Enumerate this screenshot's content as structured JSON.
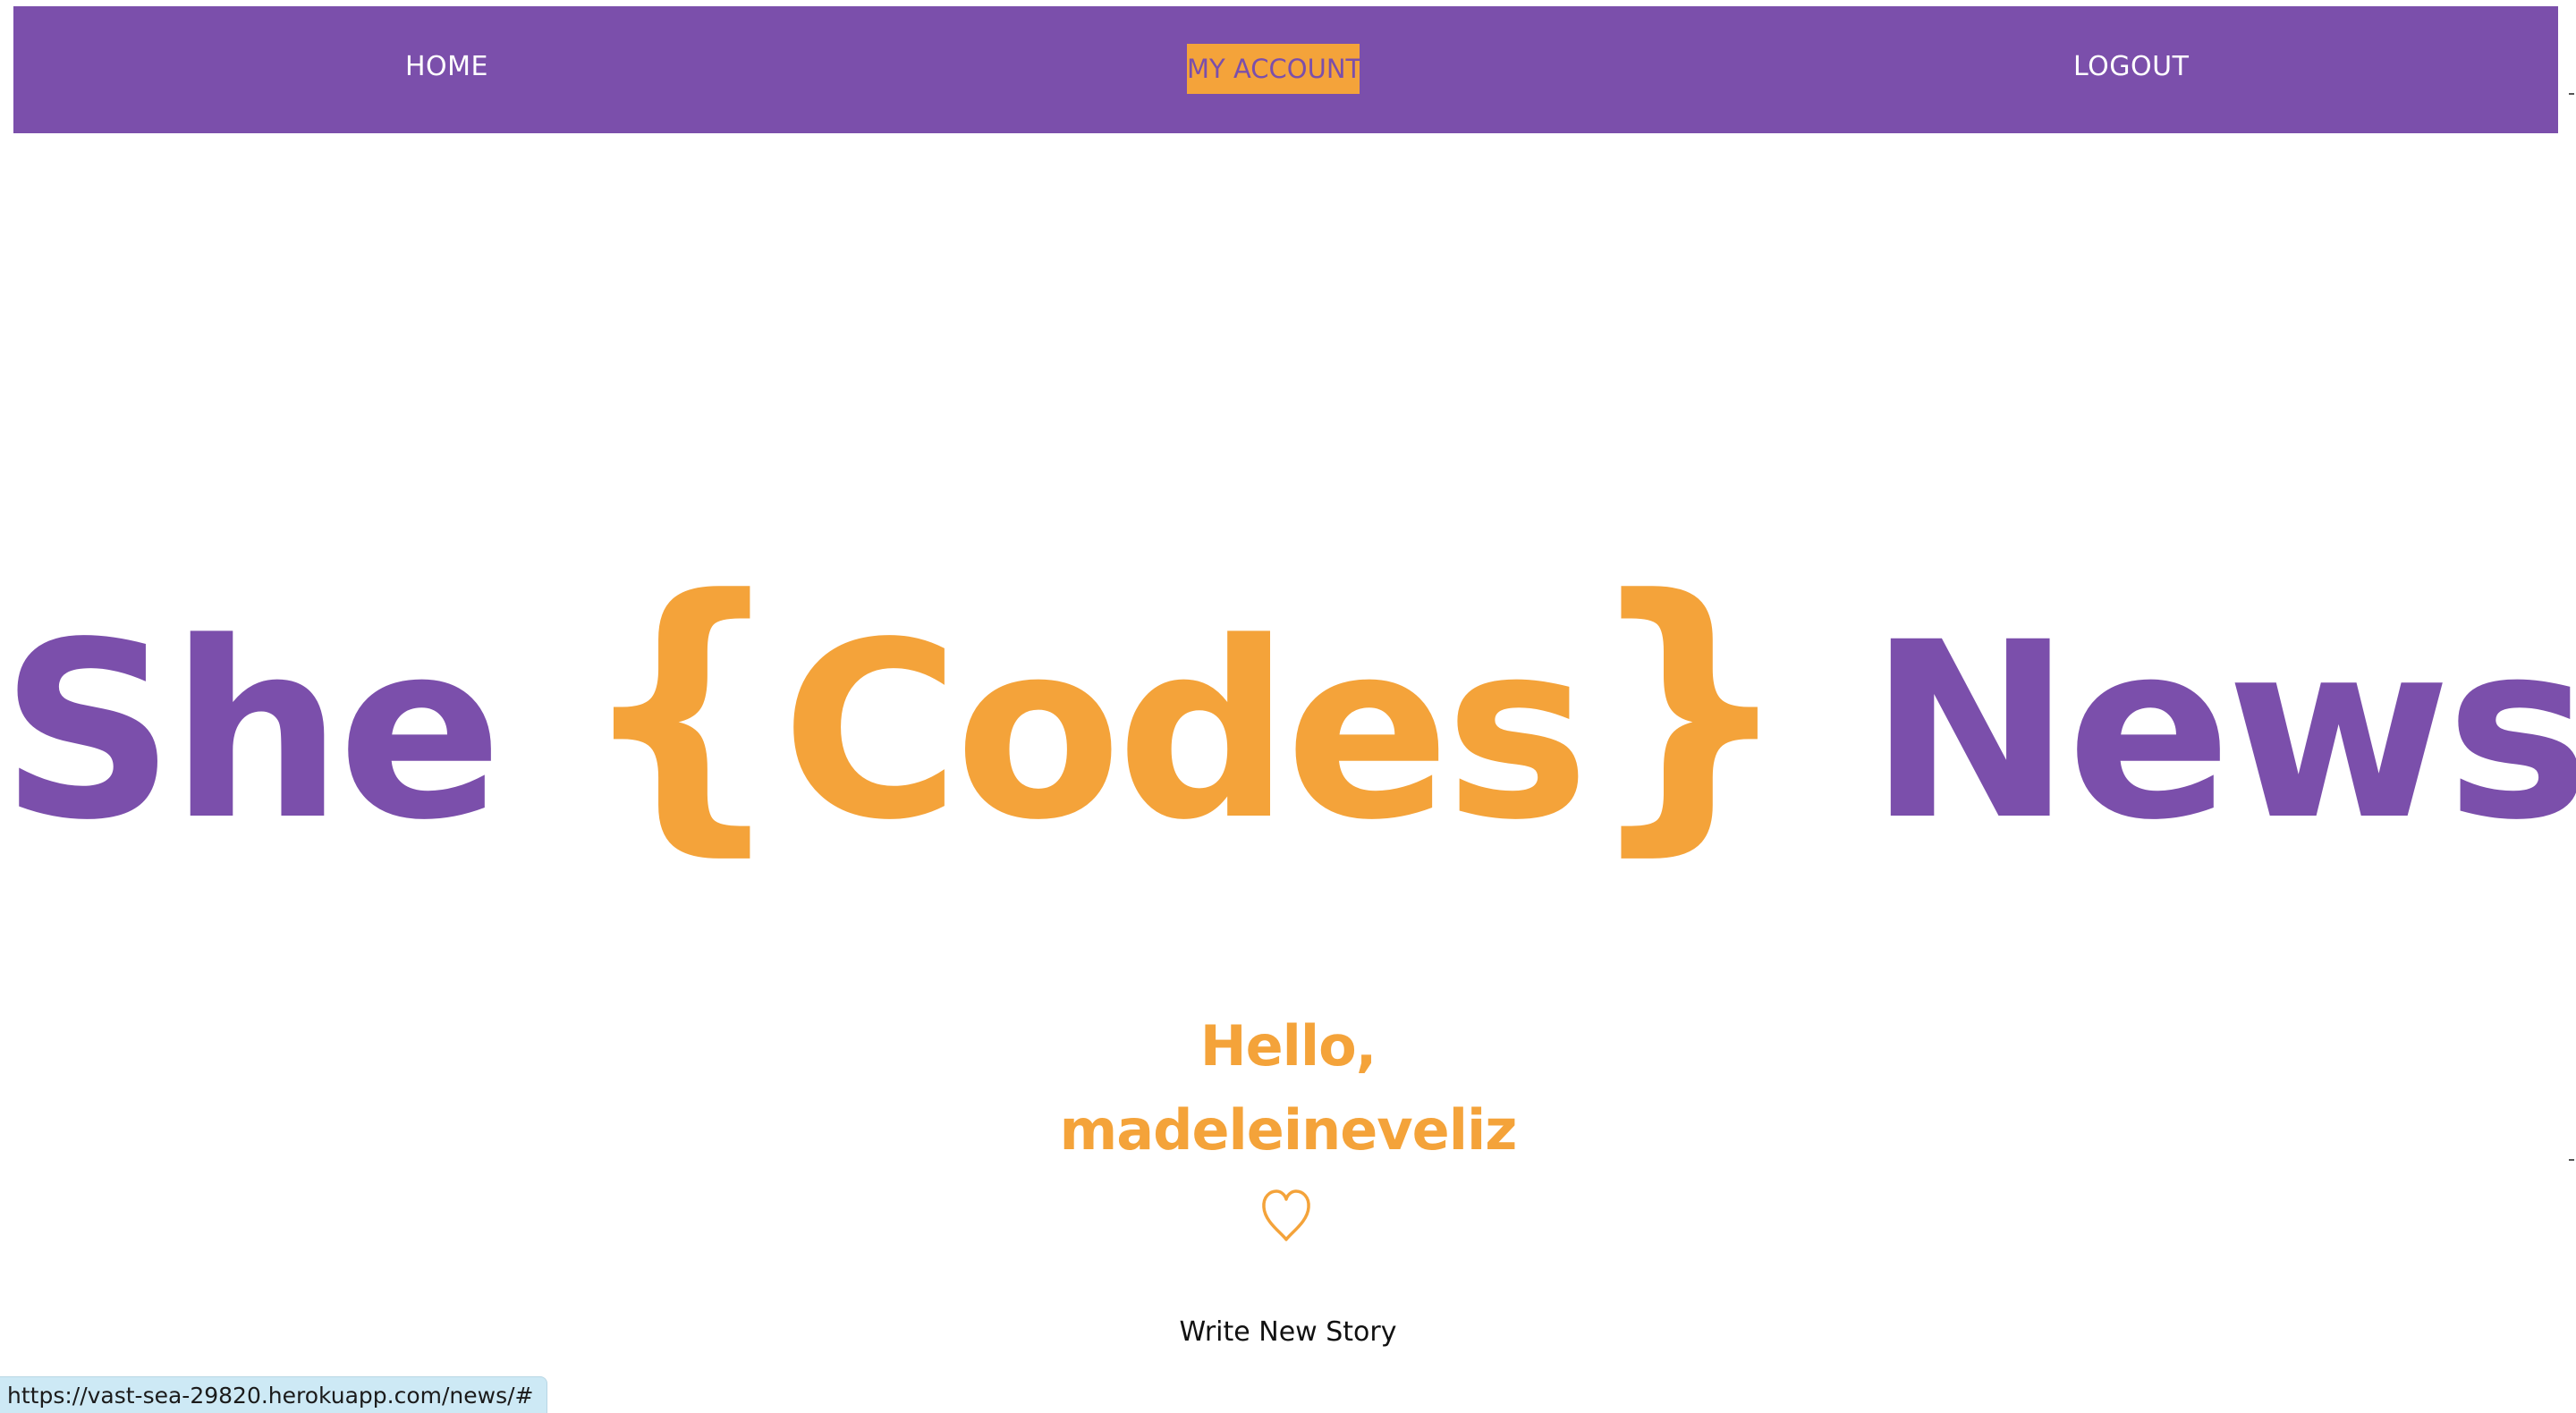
{
  "nav": {
    "home_label": "HOME",
    "account_label": "MY ACCOUNT",
    "logout_label": "LOGOUT"
  },
  "hero": {
    "word_1": "She",
    "brace_open": "{",
    "word_2": "Codes",
    "brace_close": "}",
    "word_3": "News"
  },
  "greeting": {
    "line_1": "Hello,",
    "line_2": "madeleineveliz"
  },
  "write_story_label": "Write New Story",
  "status_bar": {
    "url": "https://vast-sea-29820.herokuapp.com/news/#"
  },
  "colors": {
    "brand_purple": "#7b4fab",
    "brand_orange": "#f4a33a",
    "background": "#ffffff"
  },
  "icons": {
    "heart": "heart-outline-icon"
  }
}
